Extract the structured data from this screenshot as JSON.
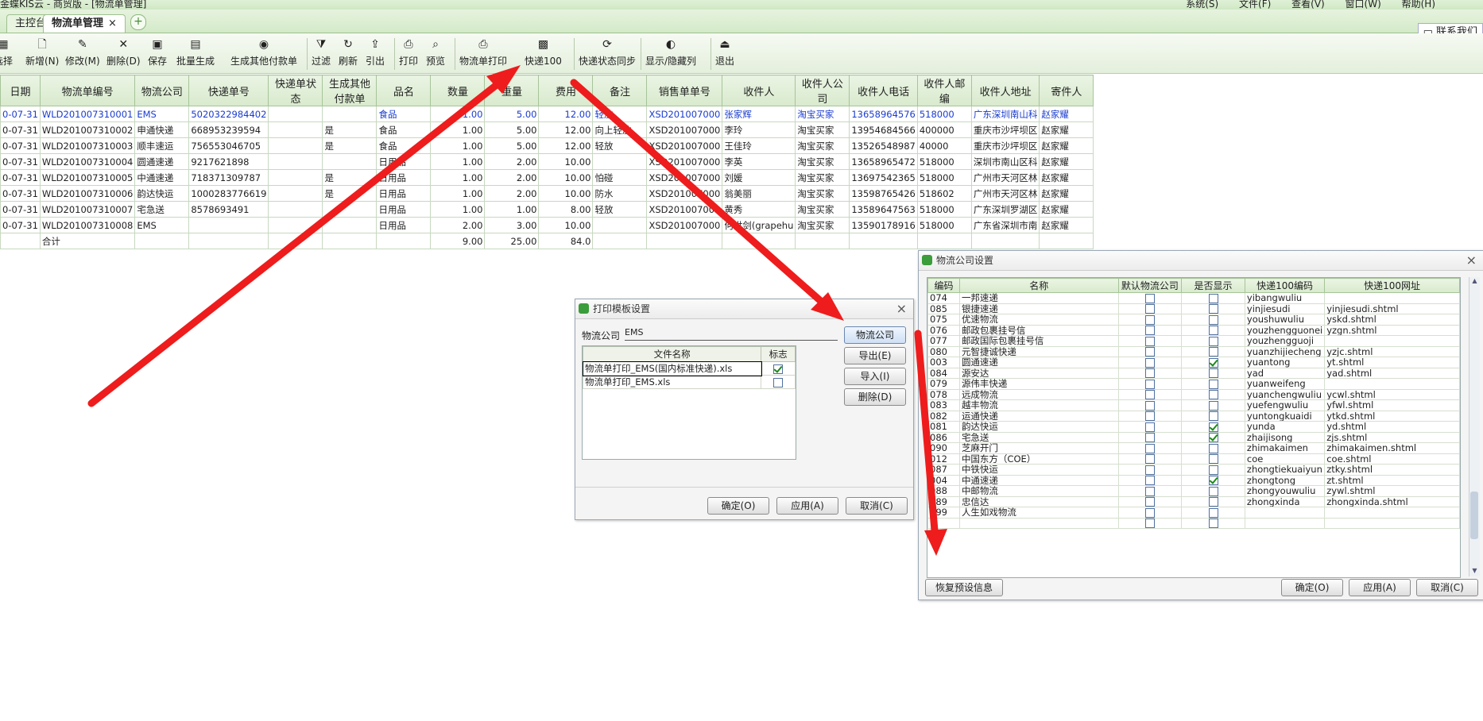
{
  "window": {
    "title": "金蝶KIS云 - 商贸版 - [物流单管理]",
    "menus": [
      "系统(S)",
      "文件(F)",
      "查看(V)",
      "窗口(W)",
      "帮助(H)"
    ]
  },
  "tabs": [
    {
      "label": "主控台"
    },
    {
      "label": "物流单管理",
      "close": "×"
    }
  ],
  "contact_label": "联系我们",
  "toolbar": {
    "items": [
      {
        "label": "选择",
        "icon": "select-icon",
        "glyph": "▦"
      },
      {
        "label": "新增(N)",
        "icon": "new-icon",
        "glyph": "🗋"
      },
      {
        "label": "修改(M)",
        "icon": "edit-icon",
        "glyph": "✎"
      },
      {
        "label": "删除(D)",
        "icon": "delete-icon",
        "glyph": "✕"
      },
      {
        "label": "保存",
        "icon": "save-icon",
        "glyph": "▣"
      },
      {
        "label": "批量生成",
        "icon": "batch-icon",
        "glyph": "▤"
      },
      {
        "label": "生成其他付款单",
        "icon": "payment-icon",
        "glyph": "◉"
      },
      {
        "label": "过滤",
        "icon": "filter-icon",
        "glyph": "⧩"
      },
      {
        "label": "刷新",
        "icon": "refresh-icon",
        "glyph": "↻"
      },
      {
        "label": "引出",
        "icon": "export-icon",
        "glyph": "⇪"
      },
      {
        "label": "打印",
        "icon": "print-icon",
        "glyph": "⎙"
      },
      {
        "label": "预览",
        "icon": "preview-icon",
        "glyph": "⌕"
      },
      {
        "label": "物流单打印",
        "icon": "logistics-print-icon",
        "glyph": "⎙"
      },
      {
        "label": "快递100",
        "icon": "kuaidi100-icon",
        "glyph": "▩"
      },
      {
        "label": "快递状态同步",
        "icon": "sync-icon",
        "glyph": "⟳"
      },
      {
        "label": "显示/隐藏列",
        "icon": "columns-icon",
        "glyph": "◐"
      },
      {
        "label": "退出",
        "icon": "exit-icon",
        "glyph": "⏏"
      }
    ]
  },
  "grid": {
    "headers": [
      "日期",
      "物流单编号",
      "物流公司",
      "快递单号",
      "快递单状态",
      "生成其他付款单",
      "品名",
      "数量",
      "重量",
      "费用",
      "备注",
      "销售单单号",
      "收件人",
      "收件人公司",
      "收件人电话",
      "收件人邮编",
      "收件人地址",
      "寄件人"
    ],
    "rows": [
      [
        "0-07-31",
        "WLD201007310001",
        "EMS",
        "5020322984402",
        "",
        "",
        "食品",
        "1.00",
        "5.00",
        "12.00",
        "轻放",
        "XSD201007000",
        "张家辉",
        "淘宝买家",
        "13658964576",
        "518000",
        "广东深圳南山科",
        "赵家耀"
      ],
      [
        "0-07-31",
        "WLD201007310002",
        "申通快递",
        "668953239594",
        "",
        "是",
        "食品",
        "1.00",
        "5.00",
        "12.00",
        "向上轻放",
        "XSD201007000",
        "李玲",
        "淘宝买家",
        "13954684566",
        "400000",
        "重庆市沙坪坝区",
        "赵家耀"
      ],
      [
        "0-07-31",
        "WLD201007310003",
        "顺丰速运",
        "756553046705",
        "",
        "是",
        "食品",
        "1.00",
        "5.00",
        "12.00",
        "轻放",
        "XSD201007000",
        "王佳玲",
        "淘宝买家",
        "13526548987",
        "40000",
        "重庆市沙坪坝区",
        "赵家耀"
      ],
      [
        "0-07-31",
        "WLD201007310004",
        "圆通速递",
        "9217621898",
        "",
        "",
        "日用品",
        "1.00",
        "2.00",
        "10.00",
        "",
        "XSD201007000",
        "李英",
        "淘宝买家",
        "13658965472",
        "518000",
        "深圳市南山区科",
        "赵家耀"
      ],
      [
        "0-07-31",
        "WLD201007310005",
        "中通速递",
        "718371309787",
        "",
        "是",
        "日用品",
        "1.00",
        "2.00",
        "10.00",
        "怕碰",
        "XSD201007000",
        "刘媛",
        "淘宝买家",
        "13697542365",
        "518000",
        "广州市天河区林",
        "赵家耀"
      ],
      [
        "0-07-31",
        "WLD201007310006",
        "韵达快运",
        "1000283776619",
        "",
        "是",
        "日用品",
        "1.00",
        "2.00",
        "10.00",
        "防水",
        "XSD201007000",
        "翁美丽",
        "淘宝买家",
        "13598765426",
        "518602",
        "广州市天河区林",
        "赵家耀"
      ],
      [
        "0-07-31",
        "WLD201007310007",
        "宅急送",
        "8578693491",
        "",
        "",
        "日用品",
        "1.00",
        "1.00",
        "8.00",
        "轻放",
        "XSD201007000",
        "黄秀",
        "淘宝买家",
        "13589647563",
        "518000",
        "广东深圳罗湖区",
        "赵家耀"
      ],
      [
        "0-07-31",
        "WLD201007310008",
        "EMS",
        "",
        "",
        "",
        "日用品",
        "2.00",
        "3.00",
        "10.00",
        "",
        "XSD201007000",
        "何世剑(grapehu",
        "淘宝买家",
        "13590178916",
        "518000",
        "广东省深圳市南",
        "赵家耀"
      ]
    ],
    "total": {
      "label": "合计",
      "qty": "9.00",
      "weight": "25.00",
      "fee": "84.0"
    }
  },
  "print_dialog": {
    "title": "打印模板设置",
    "company_label": "物流公司",
    "company_value": "EMS",
    "headers": [
      "文件名称",
      "标志"
    ],
    "rows": [
      {
        "name": "物流单打印_EMS(国内标准快递).xls",
        "checked": true
      },
      {
        "name": "物流单打印_EMS.xls",
        "checked": false
      }
    ],
    "buttons": [
      "物流公司",
      "导出(E)",
      "导入(I)",
      "删除(D)"
    ],
    "ok": "确定(O)",
    "apply": "应用(A)",
    "cancel": "取消(C)"
  },
  "logistics_dialog": {
    "title": "物流公司设置",
    "headers": [
      "编码",
      "名称",
      "默认物流公司",
      "是否显示",
      "快递100编码",
      "快递100网址"
    ],
    "rows": [
      [
        "074",
        "一邦速递",
        false,
        false,
        "yibangwuliu",
        ""
      ],
      [
        "085",
        "银捷速递",
        false,
        false,
        "yinjiesudi",
        "yinjiesudi.shtml"
      ],
      [
        "075",
        "优速物流",
        false,
        false,
        "youshuwuliu",
        "yskd.shtml"
      ],
      [
        "076",
        "邮政包裹挂号信",
        false,
        false,
        "youzhengguonei",
        "yzgn.shtml"
      ],
      [
        "077",
        "邮政国际包裹挂号信",
        false,
        false,
        "youzhengguoji",
        ""
      ],
      [
        "080",
        "元智捷诚快递",
        false,
        false,
        "yuanzhijiecheng",
        "yzjc.shtml"
      ],
      [
        "003",
        "圆通速递",
        false,
        true,
        "yuantong",
        "yt.shtml"
      ],
      [
        "084",
        "源安达",
        false,
        false,
        "yad",
        "yad.shtml"
      ],
      [
        "079",
        "源伟丰快递",
        false,
        false,
        "yuanweifeng",
        ""
      ],
      [
        "078",
        "远成物流",
        false,
        false,
        "yuanchengwuliu",
        "ycwl.shtml"
      ],
      [
        "083",
        "越丰物流",
        false,
        false,
        "yuefengwuliu",
        "yfwl.shtml"
      ],
      [
        "082",
        "运通快递",
        false,
        false,
        "yuntongkuaidi",
        "ytkd.shtml"
      ],
      [
        "081",
        "韵达快运",
        false,
        true,
        "yunda",
        "yd.shtml"
      ],
      [
        "086",
        "宅急送",
        false,
        true,
        "zhaijisong",
        "zjs.shtml"
      ],
      [
        "090",
        "芝麻开门",
        false,
        false,
        "zhimakaimen",
        "zhimakaimen.shtml"
      ],
      [
        "012",
        "中国东方（COE）",
        false,
        false,
        "coe",
        "coe.shtml"
      ],
      [
        "087",
        "中铁快运",
        false,
        false,
        "zhongtiekuaiyun",
        "ztky.shtml"
      ],
      [
        "004",
        "中通速递",
        false,
        true,
        "zhongtong",
        "zt.shtml"
      ],
      [
        "088",
        "中邮物流",
        false,
        false,
        "zhongyouwuliu",
        "zywl.shtml"
      ],
      [
        "089",
        "忠信达",
        false,
        false,
        "zhongxinda",
        "zhongxinda.shtml"
      ],
      [
        "099",
        "人生如戏物流",
        false,
        false,
        "",
        ""
      ],
      [
        "",
        "",
        false,
        false,
        "",
        ""
      ]
    ],
    "restore": "恢复预设信息",
    "ok": "确定(O)",
    "apply": "应用(A)",
    "cancel": "取消(C)"
  },
  "annotation_color": "#ee1c1c"
}
